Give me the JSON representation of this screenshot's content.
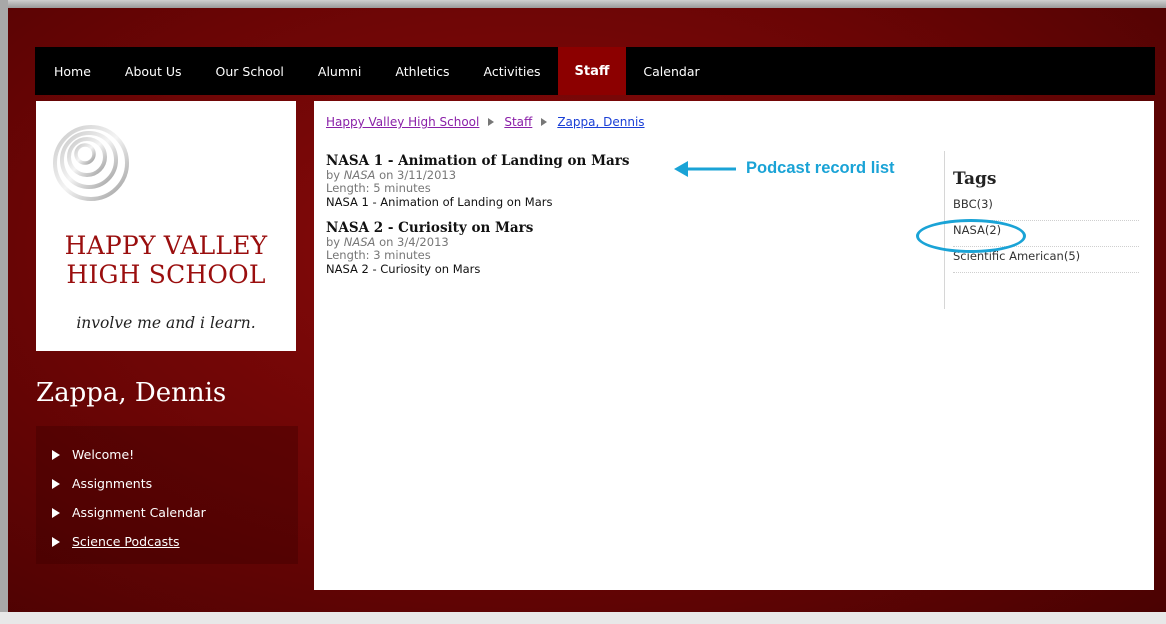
{
  "nav": {
    "items": [
      {
        "label": "Home",
        "active": false
      },
      {
        "label": "About Us",
        "active": false
      },
      {
        "label": "Our School",
        "active": false
      },
      {
        "label": "Alumni",
        "active": false
      },
      {
        "label": "Athletics",
        "active": false
      },
      {
        "label": "Activities",
        "active": false
      },
      {
        "label": "Staff",
        "active": true
      },
      {
        "label": "Calendar",
        "active": false
      }
    ]
  },
  "school": {
    "name_line1": "HAPPY VALLEY",
    "name_line2": "HIGH SCHOOL",
    "motto": "involve me and i learn.",
    "logo_icon": "concentric-swirl-logo"
  },
  "teacher": {
    "name": "Zappa, Dennis"
  },
  "side_menu": {
    "items": [
      {
        "label": "Welcome!"
      },
      {
        "label": "Assignments"
      },
      {
        "label": "Assignment Calendar"
      },
      {
        "label": "Science Podcasts"
      }
    ]
  },
  "breadcrumb": [
    "Happy Valley High School",
    "Staff",
    "Zappa, Dennis"
  ],
  "podcasts": [
    {
      "title": "NASA 1 - Animation of Landing on Mars",
      "by": "by",
      "author": "NASA",
      "on": "on",
      "date": "3/11/2013",
      "length": "Length: 5 minutes",
      "description": "NASA 1 - Animation of Landing on Mars"
    },
    {
      "title": "NASA 2 - Curiosity on Mars",
      "by": "by",
      "author": "NASA",
      "on": "on",
      "date": "3/4/2013",
      "length": "Length: 3 minutes",
      "description": "NASA 2 - Curiosity on Mars"
    }
  ],
  "annotation": {
    "label": "Podcast record list",
    "color": "#1aa3d6"
  },
  "tags": {
    "heading": "Tags",
    "items": [
      "BBC(3)",
      "NASA(2)",
      "Scientific American(5)"
    ],
    "highlighted": "NASA(2)"
  },
  "colors": {
    "brand_red": "#8c0000",
    "school_name": "#9a0e0e",
    "link_visited": "#8a1fa8",
    "link": "#1a3fd6"
  }
}
